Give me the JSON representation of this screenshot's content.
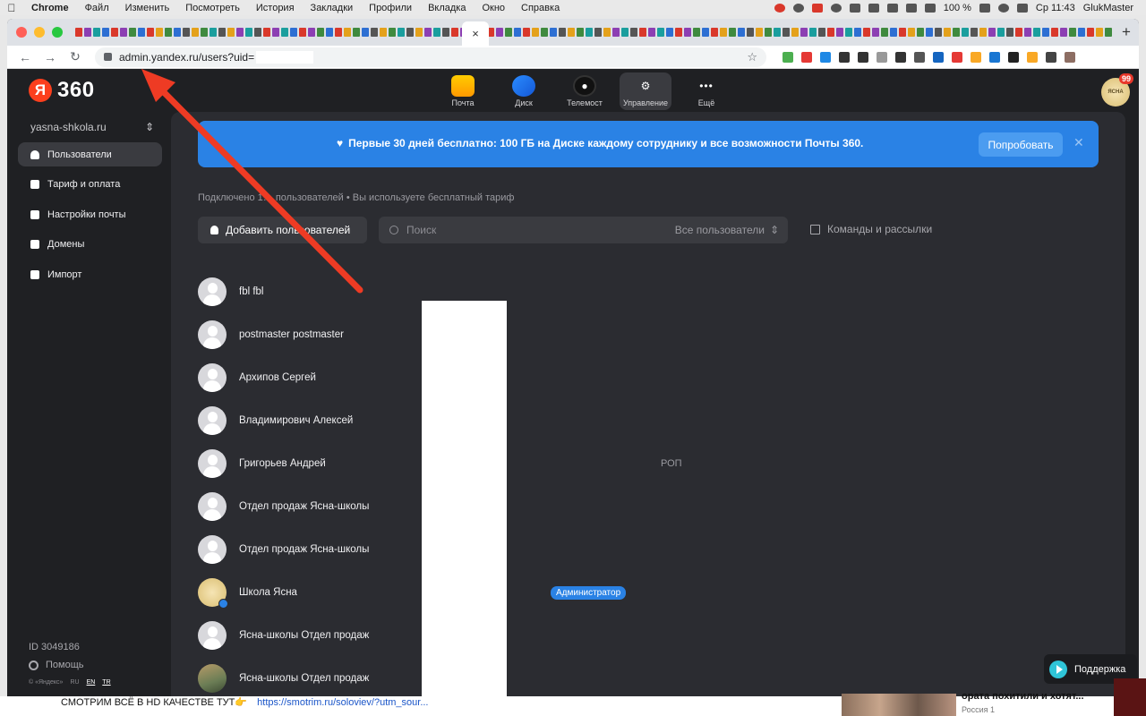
{
  "mac_menubar": {
    "app_name": "Chrome",
    "menus": [
      "Файл",
      "Изменить",
      "Посмотреть",
      "История",
      "Закладки",
      "Профили",
      "Вкладка",
      "Окно",
      "Справка"
    ],
    "battery": "100 %",
    "clock": "Ср 11:43",
    "user": "GlukMaster"
  },
  "browser": {
    "url": "admin.yandex.ru/users?uid=",
    "new_tab_glyph": "+",
    "close_tab_glyph": "×"
  },
  "app": {
    "logo_letter": "Я",
    "logo_number": "360",
    "services": [
      {
        "label": "Почта",
        "icon": "mail-icon"
      },
      {
        "label": "Диск",
        "icon": "disk-icon"
      },
      {
        "label": "Телемост",
        "icon": "telemost-icon"
      },
      {
        "label": "Управление",
        "icon": "admin-icon"
      },
      {
        "label": "Ещё",
        "icon": "more-icon"
      }
    ],
    "avatar_badge": "99",
    "avatar_text": "ЯСНА"
  },
  "sidebar": {
    "org": "yasna-shkola.ru",
    "items": [
      {
        "label": "Пользователи",
        "icon": "user-icon"
      },
      {
        "label": "Тариф и оплата",
        "icon": "grid-icon"
      },
      {
        "label": "Настройки почты",
        "icon": "envelope-icon"
      },
      {
        "label": "Домены",
        "icon": "domains-icon"
      },
      {
        "label": "Импорт",
        "icon": "import-icon"
      }
    ],
    "org_id": "ID 3049186",
    "help": "Помощь",
    "copyright": "© «Яндекс»",
    "langs": [
      "RU",
      "EN",
      "TR"
    ]
  },
  "promo": {
    "text": "Первые 30 дней бесплатно: 100 ГБ на Диске каждому сотруднику и все возможности Почты 360.",
    "button": "Попробовать"
  },
  "main": {
    "usage_text": "Подключено 1… пользователей • Вы используете бесплатный тариф",
    "add_users": "Добавить пользователей",
    "search_placeholder": "Поиск",
    "filter": "Все пользователи",
    "teams": "Команды и рассылки"
  },
  "users": [
    {
      "name": "fbl fbl",
      "avatar": "default"
    },
    {
      "name": "postmaster postmaster",
      "avatar": "default"
    },
    {
      "name": "Архипов Сергей",
      "avatar": "default"
    },
    {
      "name": "Владимирович Алексей",
      "avatar": "default"
    },
    {
      "name": "Григорьев Андрей",
      "avatar": "default",
      "position": "РОП"
    },
    {
      "name": "Отдел продаж Ясна-школы",
      "avatar": "default"
    },
    {
      "name": "Отдел продаж Ясна-школы",
      "avatar": "default"
    },
    {
      "name": "Школа Ясна",
      "avatar": "seal",
      "badge": "Администратор"
    },
    {
      "name": "Ясна-школы Отдел продаж",
      "avatar": "default"
    },
    {
      "name": "Ясна-школы Отдел продаж",
      "avatar": "photo"
    }
  ],
  "support": {
    "label": "Поддержка"
  },
  "background": {
    "text": "СМОТРИМ ВСЁ В HD КАЧЕСТВЕ ТУТ👉",
    "link": "https://smotrim.ru/soloviev/?utm_sour...",
    "news": "ората похитили и хотят...",
    "news_sub": "Россия 1"
  }
}
